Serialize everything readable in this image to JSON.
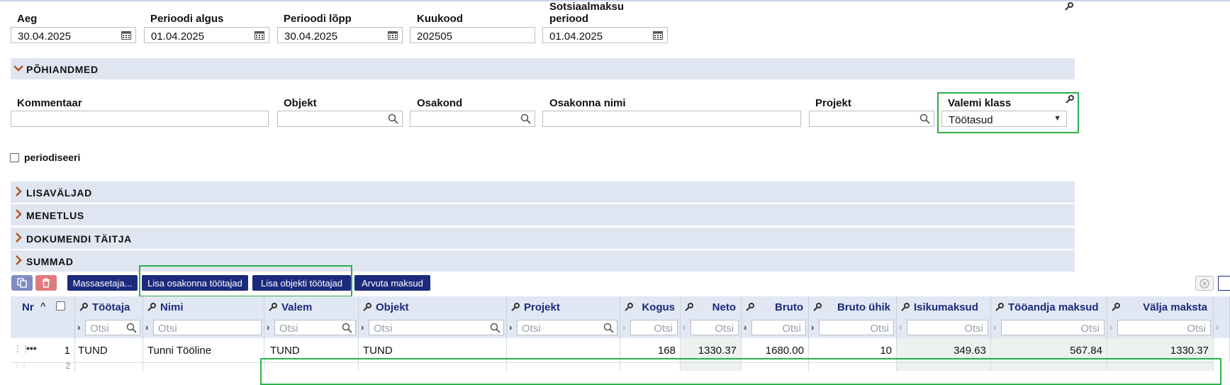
{
  "header_fields": {
    "aeg": {
      "label": "Aeg",
      "value": "30.04.2025"
    },
    "perioodi_algus": {
      "label": "Perioodi algus",
      "value": "01.04.2025"
    },
    "perioodi_lopp": {
      "label": "Perioodi lõpp",
      "value": "30.04.2025"
    },
    "kuukood": {
      "label": "Kuukood",
      "value": "202505"
    },
    "sotsiaalmaksu_periood": {
      "label_line1": "Sotsiaalmaksu",
      "label_line2": "periood",
      "value": "01.04.2025"
    }
  },
  "sections": {
    "pohiandmed": "PÕHIANDMED",
    "lisavaljad": "LISAVÄLJAD",
    "menetlus": "MENETLUS",
    "dokumendi_taitja": "DOKUMENDI TÄITJA",
    "summad": "SUMMAD"
  },
  "main_fields": {
    "kommentaar": {
      "label": "Kommentaar",
      "value": ""
    },
    "objekt": {
      "label": "Objekt",
      "value": ""
    },
    "osakond": {
      "label": "Osakond",
      "value": ""
    },
    "osakonna_nimi": {
      "label": "Osakonna nimi",
      "value": ""
    },
    "projekt": {
      "label": "Projekt",
      "value": ""
    },
    "valemi_klass": {
      "label": "Valemi klass",
      "value": "Töötasud"
    }
  },
  "periodiseeri": {
    "label": "periodiseeri",
    "checked": false
  },
  "toolbar": {
    "massasetaja": "Massasetaja...",
    "lisa_osakonna": "Lisa osakonna töötajad",
    "lisa_objekti": "Lisa objekti töötajad",
    "arvuta_maksud": "Arvuta maksud"
  },
  "table": {
    "columns": {
      "nr": "Nr",
      "tootaja": "Töötaja",
      "nimi": "Nimi",
      "valem": "Valem",
      "objekt": "Objekt",
      "projekt": "Projekt",
      "kogus": "Kogus",
      "neto": "Neto",
      "bruto": "Bruto",
      "bruto_uhik": "Bruto ühik",
      "isikumaksud": "Isikumaksud",
      "tooandja_maksud": "Tööandja maksud",
      "valja_maksta": "Välja maksta"
    },
    "filter_placeholder": "Otsi",
    "rows": [
      {
        "nr": "1",
        "tootaja": "TUND",
        "nimi": "Tunni Tööline",
        "valem": "TUND",
        "objekt": "TUND",
        "projekt": "",
        "kogus": "168",
        "neto": "1330.37",
        "bruto": "1680.00",
        "bruto_uhik": "10",
        "isikumaksud": "349.63",
        "tooandja_maksud": "567.84",
        "valja_maksta": "1330.37"
      }
    ],
    "next_row_nr": "2"
  },
  "colors": {
    "section_bg": "#dfe6f2",
    "button_bg": "#1b2a7c",
    "highlight": "#2db04b",
    "chevron": "#b5541c"
  }
}
